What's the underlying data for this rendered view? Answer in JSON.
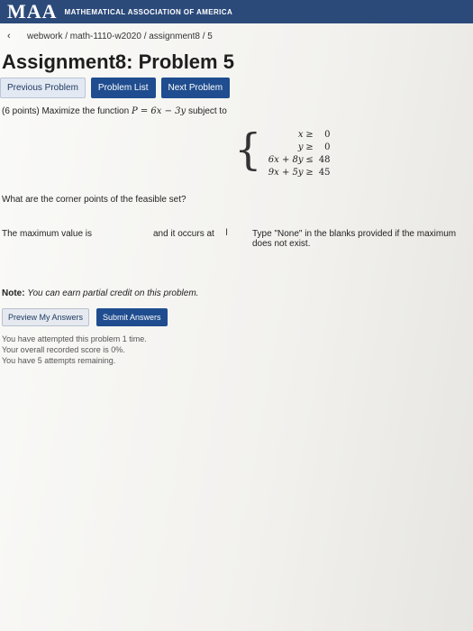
{
  "header": {
    "logo": "MAA",
    "organization": "MATHEMATICAL ASSOCIATION OF AMERICA",
    "back_icon": "back-arrow-icon"
  },
  "breadcrumb": "webwork / math-1110-w2020 / assignment8 / 5",
  "title": "Assignment8: Problem 5",
  "nav": {
    "previous": "Previous Problem",
    "list": "Problem List",
    "next": "Next Problem"
  },
  "problem": {
    "points": "(6 points)",
    "statement_prefix": "Maximize the function",
    "function": "P = 6x − 3y",
    "statement_suffix": "subject to",
    "constraints": [
      {
        "lhs": "x",
        "op": "≥",
        "rhs": "0"
      },
      {
        "lhs": "y",
        "op": "≥",
        "rhs": "0"
      },
      {
        "lhs": "6x + 8y",
        "op": "≤",
        "rhs": "48"
      },
      {
        "lhs": "9x + 5y",
        "op": "≥",
        "rhs": "45"
      }
    ],
    "question": "What are the corner points of the feasible set?",
    "max_label": "The maximum value is",
    "occurs_label": "and it occurs at",
    "hint": "Type \"None\" in the blanks provided if the maximum does not exist.",
    "max_value": "",
    "occurs_value": ""
  },
  "note": {
    "label": "Note:",
    "text": "You can earn partial credit on this problem."
  },
  "answers": {
    "preview": "Preview My Answers",
    "submit": "Submit Answers"
  },
  "status": {
    "attempted": "You have attempted this problem 1 time.",
    "score": "Your overall recorded score is 0%.",
    "remaining": "You have 5 attempts remaining."
  }
}
